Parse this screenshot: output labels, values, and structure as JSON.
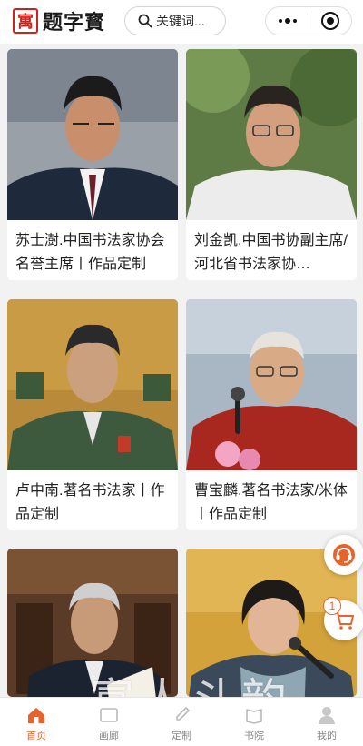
{
  "header": {
    "logo_seal": "寓",
    "logo_text": "题字寳",
    "search_placeholder": "关键词..."
  },
  "cards": [
    {
      "caption": "苏士澍.中国书法家协会名誉主席丨作品定制"
    },
    {
      "caption": "刘金凯.中国书协副主席/河北省书法家协…"
    },
    {
      "caption": "卢中南.著名书法家丨作品定制"
    },
    {
      "caption": "曹宝麟.著名书法家/米体丨作品定制"
    },
    {
      "caption": ""
    },
    {
      "caption": ""
    }
  ],
  "floating": {
    "cart_count": "1"
  },
  "watermark": "富人斗韵",
  "tabbar": {
    "items": [
      {
        "label": "首页",
        "active": true
      },
      {
        "label": "画廊",
        "active": false
      },
      {
        "label": "定制",
        "active": false
      },
      {
        "label": "书院",
        "active": false
      },
      {
        "label": "我的",
        "active": false
      }
    ]
  },
  "colors": {
    "accent": "#e8622c",
    "logo_red": "#d0221a"
  }
}
